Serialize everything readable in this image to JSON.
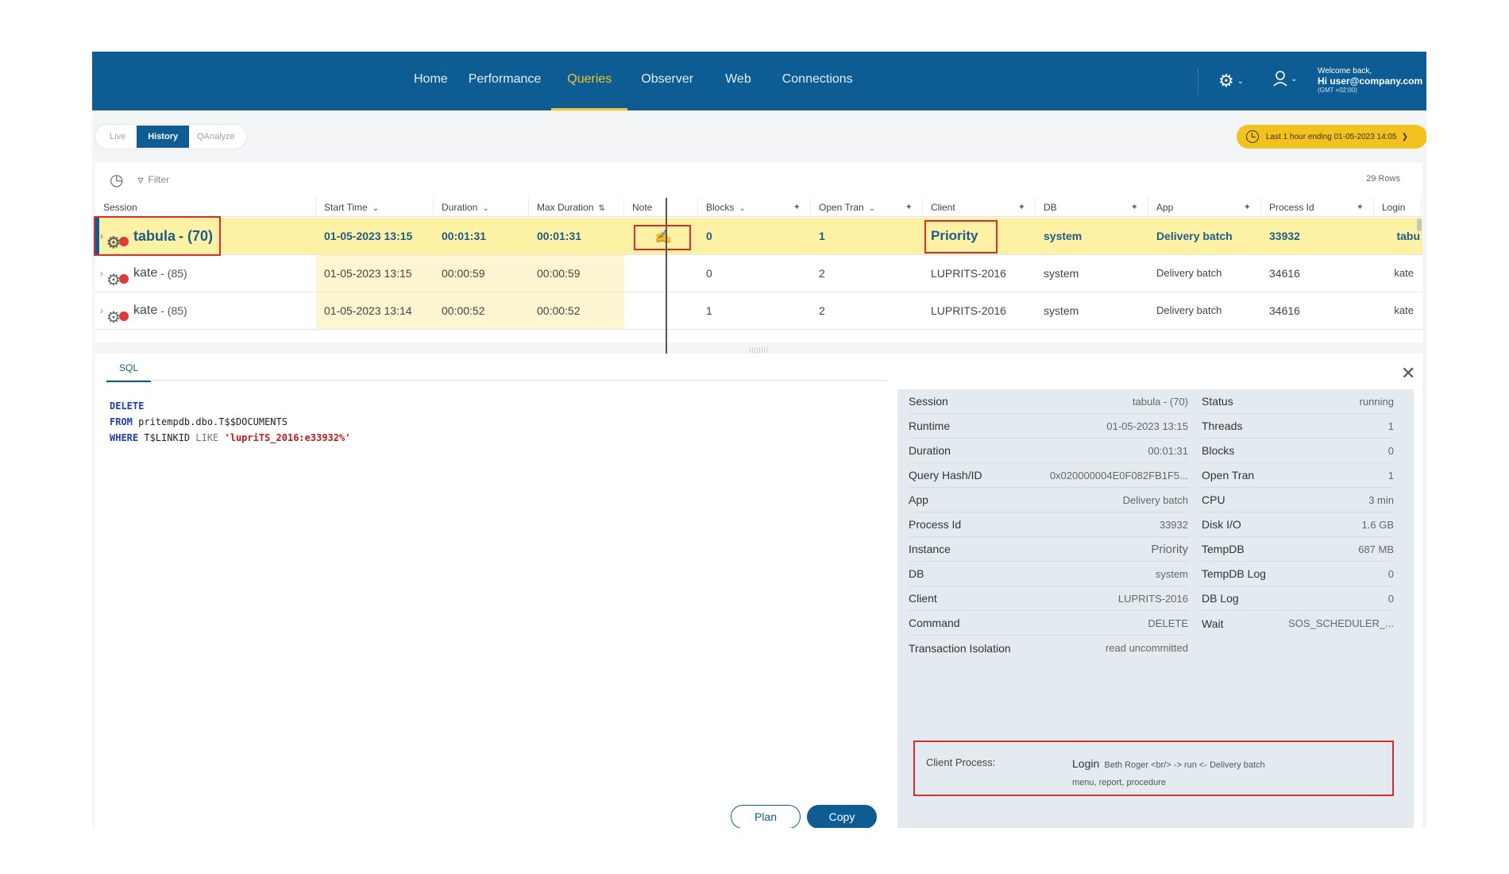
{
  "nav": {
    "items": [
      "Home",
      "Performance",
      "Queries",
      "Observer",
      "Web",
      "Connections"
    ],
    "active": "Queries",
    "welcome_line1": "Welcome back,",
    "welcome_line2": "Hi user@company.com",
    "welcome_tz": "(GMT +02:00)",
    "settings_icon": "gear-icon",
    "user_icon": "user-icon"
  },
  "mode_tabs": [
    "Live",
    "History",
    "QAnalyze"
  ],
  "time_filter": "Last 1 hour ending 01-05-2023 14:05",
  "toolbar": {
    "filter_label": "Filter",
    "rows_count": "29 Rows"
  },
  "grid": {
    "columns": {
      "session": "Session",
      "start_time": "Start Time",
      "duration": "Duration",
      "max_duration": "Max Duration",
      "note": "Note",
      "blocks": "Blocks",
      "open_tran": "Open Tran",
      "client": "Client",
      "db": "DB",
      "app": "App",
      "process_id": "Process Id",
      "login": "Login"
    },
    "rows": [
      {
        "name": "tabula",
        "num": "- (70)",
        "start_time": "01-05-2023 13:15",
        "duration": "00:01:31",
        "max_duration": "00:01:31",
        "blocks": "0",
        "open_tran": "1",
        "client": "Priority",
        "db": "system",
        "app": "Delivery batch",
        "process_id": "33932",
        "login": "tabu"
      },
      {
        "name": "kate",
        "num": "- (85)",
        "start_time": "01-05-2023 13:15",
        "duration": "00:00:59",
        "max_duration": "00:00:59",
        "blocks": "0",
        "open_tran": "2",
        "client": "LUPRITS-2016",
        "db": "system",
        "app": "Delivery batch",
        "process_id": "34616",
        "login": "kate"
      },
      {
        "name": "kate",
        "num": "- (85)",
        "start_time": "01-05-2023 13:14",
        "duration": "00:00:52",
        "max_duration": "00:00:52",
        "blocks": "1",
        "open_tran": "2",
        "client": "LUPRITS-2016",
        "db": "system",
        "app": "Delivery batch",
        "process_id": "34616",
        "login": "kate"
      }
    ]
  },
  "sql": {
    "tab_label": "SQL",
    "line1_kw": "DELETE",
    "line2_kw": "FROM",
    "line2_rest": " pritempdb.dbo.T$$DOCUMENTS",
    "line3_kw": "WHERE",
    "line3_mid": " T$LINKID ",
    "line3_like": "LIKE",
    "line3_str": " 'lupriTS_2016:e33932%'"
  },
  "buttons": {
    "plan": "Plan",
    "copy": "Copy"
  },
  "details_left": [
    {
      "k": "Session",
      "v": "tabula - (70)"
    },
    {
      "k": "Runtime",
      "v": "01-05-2023 13:15"
    },
    {
      "k": "Duration",
      "v": "00:01:31"
    },
    {
      "k": "Query Hash/ID",
      "v": "0x020000004E0F082FB1F5..."
    },
    {
      "k": "App",
      "v": "Delivery batch"
    },
    {
      "k": "Process Id",
      "v": "33932"
    },
    {
      "k": "Instance",
      "v": "Priority"
    },
    {
      "k": "DB",
      "v": "system"
    },
    {
      "k": "Client",
      "v": "LUPRITS-2016"
    },
    {
      "k": "Command",
      "v": "DELETE"
    },
    {
      "k": "Transaction Isolation",
      "v": "read uncommitted"
    }
  ],
  "details_right": [
    {
      "k": "Status",
      "v": "running"
    },
    {
      "k": "Threads",
      "v": "1"
    },
    {
      "k": "Blocks",
      "v": "0"
    },
    {
      "k": "Open Tran",
      "v": "1"
    },
    {
      "k": "CPU",
      "v": "3 min"
    },
    {
      "k": "Disk I/O",
      "v": "1.6 GB"
    },
    {
      "k": "TempDB",
      "v": "687 MB"
    },
    {
      "k": "TempDB Log",
      "v": "0"
    },
    {
      "k": "DB Log",
      "v": "0"
    },
    {
      "k": "Wait",
      "v": "SOS_SCHEDULER_..."
    }
  ],
  "client_process": {
    "label": "Client Process:",
    "login_word": "Login",
    "rest": "Beth Roger <br/> -> run <- Delivery batch",
    "line2": "menu, report, procedure"
  },
  "colors": {
    "nav_bg": "#0d5d94",
    "accent": "#f3c623",
    "highlight_row": "#fdf1a3",
    "annotation": "#e12a2a"
  }
}
